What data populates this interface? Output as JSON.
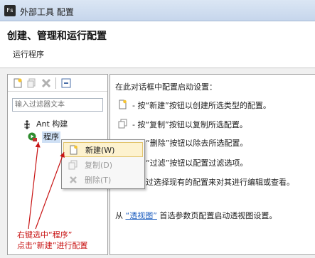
{
  "window": {
    "app_icon_text": "Fs",
    "title": "外部工具 配置"
  },
  "header": {
    "title": "创建、管理和运行配置",
    "subtitle": "运行程序"
  },
  "toolbar": {
    "buttons": [
      "new-config-icon",
      "duplicate-icon",
      "delete-icon",
      "collapse-icon"
    ]
  },
  "filter": {
    "placeholder": "输入过滤器文本"
  },
  "tree": {
    "items": [
      {
        "label": "Ant 构建",
        "icon": "ant-icon"
      },
      {
        "label": "程序",
        "icon": "program-icon"
      }
    ]
  },
  "context_menu": {
    "items": [
      {
        "label": "新建(W)",
        "state": "selected"
      },
      {
        "label": "复制(D)",
        "state": "disabled"
      },
      {
        "label": "删除(T)",
        "state": "disabled"
      }
    ]
  },
  "right_pane": {
    "intro": "在此对话框中配置启动设置：",
    "lines": [
      "- 按“新建”按钮以创建所选类型的配置。",
      "- 按“复制”按钮以复制所选配置。",
      "“删除”按钮以除去所选配置。",
      "“过滤”按钮以配置过滤选项。",
      "过选择现有的配置来对其进行编辑或查看。"
    ],
    "footer_prefix": "从",
    "footer_link": "“透视图”",
    "footer_suffix": "首选参数页配置启动透视图设置。"
  },
  "annotation": {
    "line1": "右键选中“程序”",
    "line2": "点击“新建”进行配置"
  },
  "colors": {
    "annotation": "#c81414",
    "arrow": "#c81414",
    "link": "#2060c0",
    "selected_bg": "#fdf2cf"
  }
}
